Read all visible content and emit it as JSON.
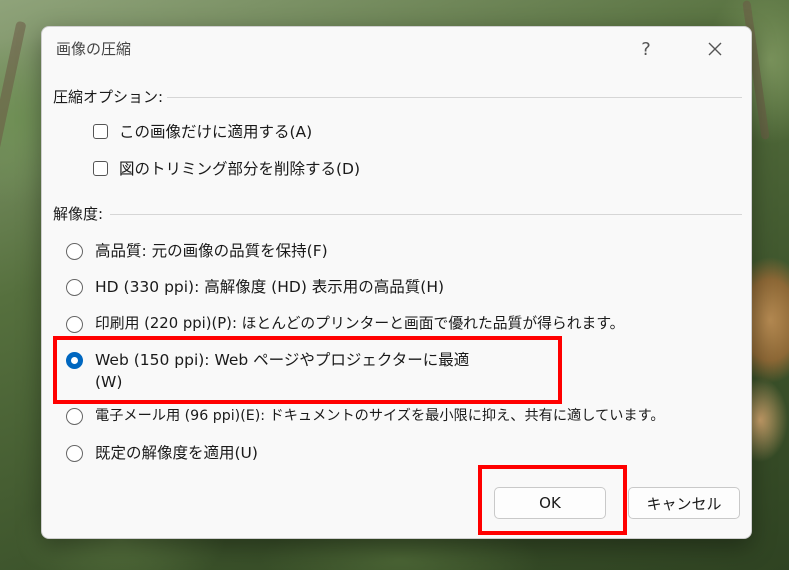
{
  "dialog": {
    "title": "画像の圧縮",
    "help": "?",
    "close": "✕"
  },
  "compression": {
    "label": "圧縮オプション:",
    "options": [
      {
        "label": "この画像だけに適用する(A)",
        "checked": false
      },
      {
        "label": "図のトリミング部分を削除する(D)",
        "checked": false
      }
    ]
  },
  "resolution": {
    "label": "解像度:",
    "options": [
      {
        "label": "高品質: 元の画像の品質を保持(F)",
        "selected": false
      },
      {
        "label": "HD (330 ppi): 高解像度 (HD) 表示用の高品質(H)",
        "selected": false
      },
      {
        "label": "印刷用 (220 ppi)(P): ほとんどのプリンターと画面で優れた品質が得られます。",
        "selected": false
      },
      {
        "label": "Web (150 ppi): Web ページやプロジェクターに最適(W)",
        "selected": true
      },
      {
        "label": "電子メール用 (96 ppi)(E): ドキュメントのサイズを最小限に抑え、共有に適しています。",
        "selected": false
      },
      {
        "label": "既定の解像度を適用(U)",
        "selected": false
      }
    ]
  },
  "buttons": {
    "ok": "OK",
    "cancel": "キャンセル"
  },
  "colors": {
    "accent": "#0067c0",
    "highlight": "#ff0000"
  }
}
